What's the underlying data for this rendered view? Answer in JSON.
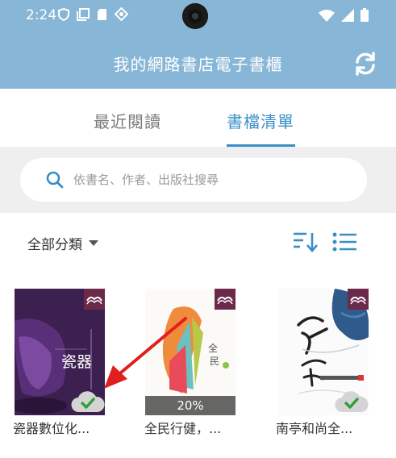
{
  "status_bar": {
    "time": "2:24"
  },
  "header": {
    "title": "我的網路書店電子書櫃"
  },
  "tabs": [
    {
      "label": "最近閱讀"
    },
    {
      "label": "書檔清單"
    }
  ],
  "search": {
    "placeholder": "依書名、作者、出版社搜尋",
    "value": ""
  },
  "filter": {
    "label": "全部分類"
  },
  "colors": {
    "header": "#87b6d6",
    "accent": "#3a8ec8",
    "search_bg": "#efefef"
  },
  "books": [
    {
      "title": "瓷器數位化...",
      "cover_text": "瓷器",
      "download_status": "downloaded"
    },
    {
      "title": "全民行健，...",
      "progress_label": "20%",
      "progress": 0.2,
      "download_status": "downloaded"
    },
    {
      "title": "南亭和尚全...",
      "download_status": "downloaded"
    }
  ]
}
